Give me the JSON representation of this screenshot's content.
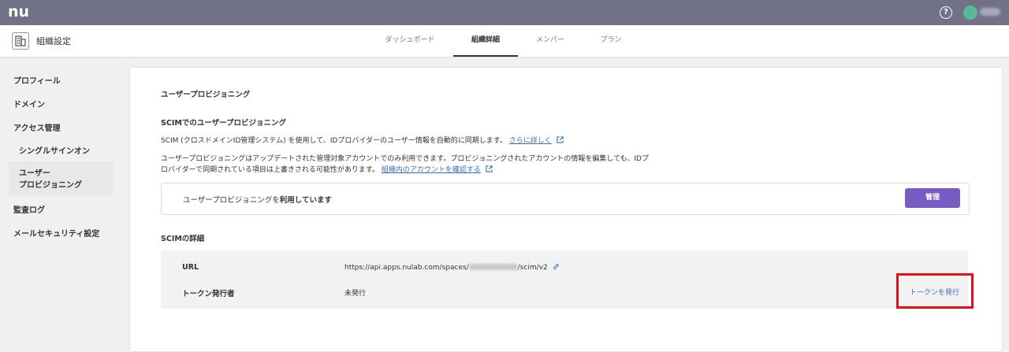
{
  "topbar": {
    "logo": "nu",
    "help": "?"
  },
  "header": {
    "org_title": "組織設定",
    "tabs": [
      {
        "label": "ダッシュボード",
        "active": false
      },
      {
        "label": "組織詳細",
        "active": true
      },
      {
        "label": "メンバー",
        "active": false
      },
      {
        "label": "プラン",
        "active": false
      }
    ]
  },
  "sidebar": {
    "items": [
      "プロフィール",
      "ドメイン",
      "アクセス管理"
    ],
    "sub_items": [
      "シングルサインオン"
    ],
    "active_line1": "ユーザー",
    "active_line2": "プロビジョニング",
    "after": [
      "監査ログ",
      "メールセキュリティ設定"
    ]
  },
  "main": {
    "title": "ユーザープロビジョニング",
    "scim_heading": "SCIMでのユーザープロビジョニング",
    "desc1": "SCIM (クロスドメインID管理システム) を使用して、IDプロバイダーのユーザー情報を自動的に同期します。",
    "desc1_link": "さらに詳しく",
    "desc2_line1": "ユーザープロビジョニングはアップデートされた管理対象アカウントでのみ利用できます。プロビジョニングされたアカウントの情報を編集しても、IDプ",
    "desc2_line2": "ロバイダーで同期されている項目は上書きされる可能性があります。",
    "desc2_link": "組織内のアカウントを確認する",
    "status_prefix": "ユーザープロビジョニングを",
    "status_bold": "利用しています",
    "manage_button": "管理",
    "details_heading": "SCIMの詳細",
    "url_label": "URL",
    "url_prefix": "https://api.apps.nulab.com/spaces/",
    "url_suffix": "/scim/v2",
    "token_label": "トークン発行者",
    "token_value": "未発行",
    "token_action": "トークンを発行"
  },
  "colors": {
    "topbar": "#717287",
    "accent": "#7a5bc1",
    "link": "#3672b4",
    "highlight": "#e0101a"
  }
}
